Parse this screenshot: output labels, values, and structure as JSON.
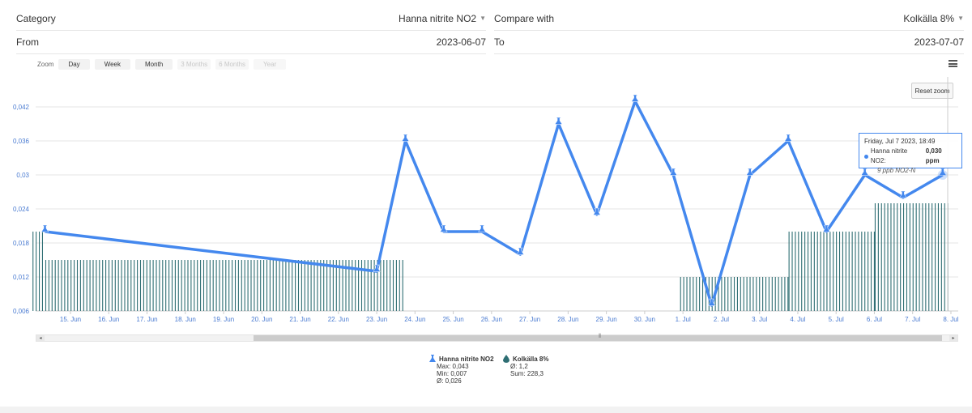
{
  "form": {
    "category_label": "Category",
    "category_value": "Hanna nitrite NO2",
    "compare_label": "Compare with",
    "compare_value": "Kolkälla 8%",
    "from_label": "From",
    "from_value": "2023-06-07",
    "to_label": "To",
    "to_value": "2023-07-07"
  },
  "zoom": {
    "label": "Zoom",
    "buttons": [
      {
        "label": "Day",
        "enabled": true
      },
      {
        "label": "Week",
        "enabled": true
      },
      {
        "label": "Month",
        "enabled": true
      },
      {
        "label": "3 Months",
        "enabled": false
      },
      {
        "label": "6 Months",
        "enabled": false
      },
      {
        "label": "Year",
        "enabled": false
      }
    ],
    "reset_label": "Reset zoom",
    "menu_icon": "hamburger-icon"
  },
  "tooltip": {
    "date": "Friday, Jul 7 2023, 18:49",
    "series": "Hanna nitrite NO2:",
    "value": "0,030 ppm",
    "note": "9 ppb NO2-N"
  },
  "legend": {
    "series1": {
      "name": "Hanna nitrite NO2",
      "max": "Max: 0,043",
      "min": "Min: 0,007",
      "avg": "Ø: 0,026",
      "icon": "flask-icon"
    },
    "series2": {
      "name": "Kolkälla 8%",
      "avg": "Ø: 1,2",
      "sum": "Sum: 228,3",
      "icon": "drop-icon"
    }
  },
  "colors": {
    "line": "#4488ee",
    "bars": "#2e6e73",
    "axis_labels": "#4a7bd1"
  },
  "chart_data": {
    "type": "line",
    "x_tick_labels": [
      "15. Jun",
      "16. Jun",
      "17. Jun",
      "18. Jun",
      "19. Jun",
      "20. Jun",
      "21. Jun",
      "22. Jun",
      "23. Jun",
      "24. Jun",
      "25. Jun",
      "26. Jun",
      "27. Jun",
      "28. Jun",
      "29. Jun",
      "30. Jun",
      "1. Jul",
      "2. Jul",
      "3. Jul",
      "4. Jul",
      "5. Jul",
      "6. Jul",
      "7. Jul",
      "8. Jul"
    ],
    "y_tick_labels": [
      "0,006",
      "0,012",
      "0,018",
      "0,024",
      "0,03",
      "0,036",
      "0,042"
    ],
    "ylim": [
      0.006,
      0.042
    ],
    "series": [
      {
        "name": "Hanna nitrite NO2",
        "x": [
          "2023-06-14 08:00",
          "2023-06-23 00:00",
          "2023-06-23 18:00",
          "2023-06-24 18:00",
          "2023-06-25 18:00",
          "2023-06-26 18:00",
          "2023-06-27 18:00",
          "2023-06-28 18:00",
          "2023-06-29 18:00",
          "2023-06-30 18:00",
          "2023-07-01 18:00",
          "2023-07-02 18:00",
          "2023-07-03 18:00",
          "2023-07-04 18:00",
          "2023-07-05 18:00",
          "2023-07-06 18:00",
          "2023-07-07 18:49"
        ],
        "values": [
          0.02,
          0.013,
          0.036,
          0.02,
          0.02,
          0.016,
          0.039,
          0.023,
          0.043,
          0.03,
          0.007,
          0.03,
          0.036,
          0.02,
          0.03,
          0.026,
          0.03
        ]
      },
      {
        "name": "Kolkälla 8%",
        "segments": [
          {
            "x_start": "2023-06-14 00:00",
            "x_end": "2023-06-14 08:00",
            "value": 0.02
          },
          {
            "x_start": "2023-06-14 08:00",
            "x_end": "2023-06-23 18:00",
            "value": 0.015
          },
          {
            "x_start": "2023-06-30 22:00",
            "x_end": "2023-07-03 18:00",
            "value": 0.012
          },
          {
            "x_start": "2023-07-03 18:00",
            "x_end": "2023-07-06 00:00",
            "value": 0.02
          },
          {
            "x_start": "2023-07-06 00:00",
            "x_end": "2023-07-07 23:00",
            "value": 0.025
          }
        ]
      }
    ]
  }
}
